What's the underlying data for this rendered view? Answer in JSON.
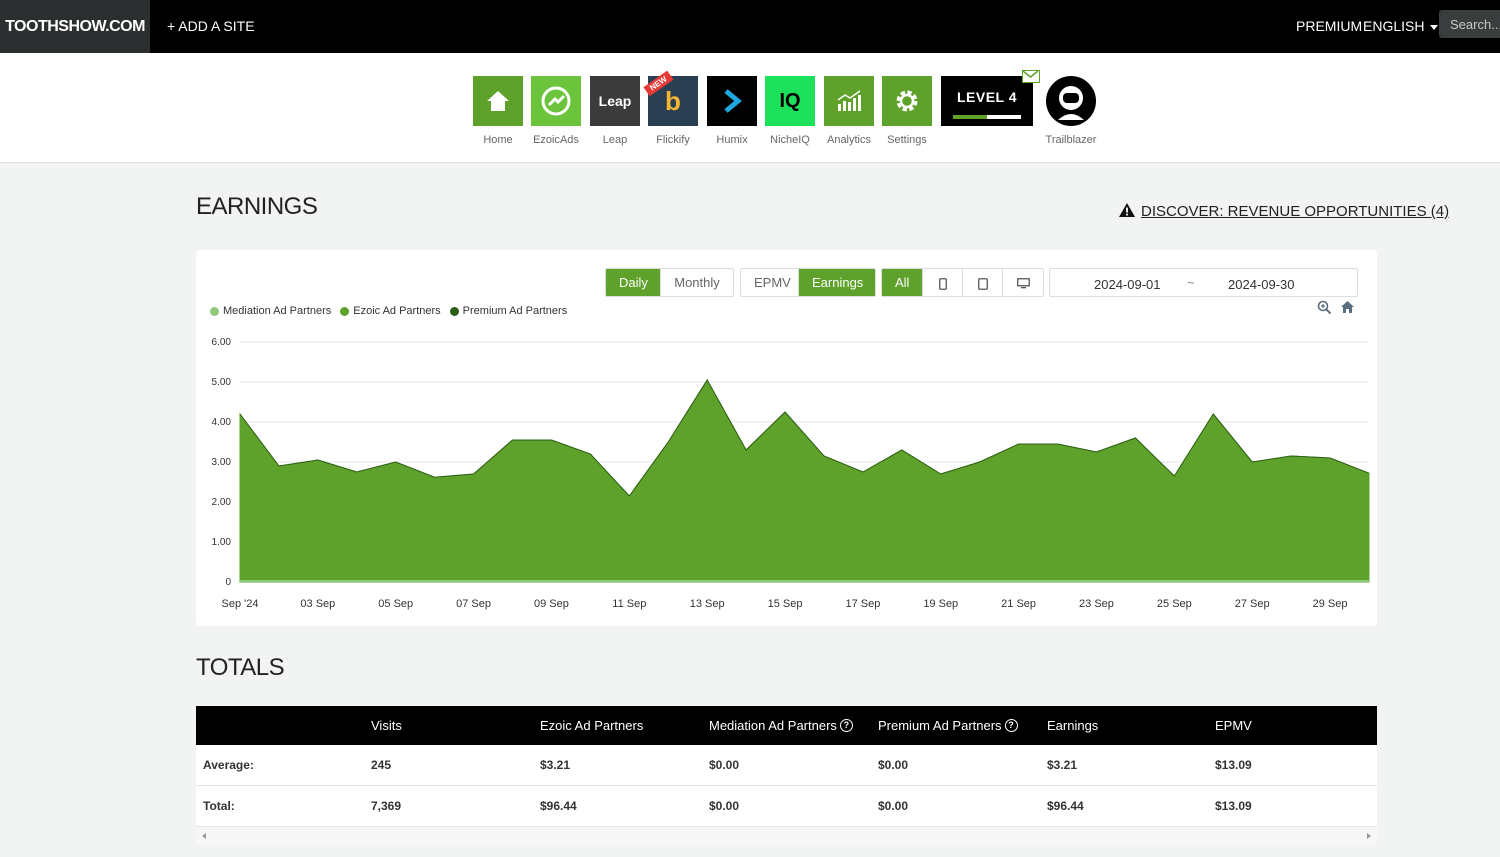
{
  "topbar": {
    "brand": "TOOTHSHOW.COM",
    "add_site": "+ ADD A SITE",
    "premium": "PREMIUM",
    "language": "ENGLISH",
    "search_placeholder": "Search..."
  },
  "apps": [
    {
      "label": "Home",
      "color": "#5ea12b"
    },
    {
      "label": "EzoicAds",
      "color": "#6cc43c"
    },
    {
      "label": "Leap",
      "color": "#3b3b3b"
    },
    {
      "label": "Flickify",
      "color": "#2b3f52",
      "badge": "NEW"
    },
    {
      "label": "Humix",
      "color": "#000000"
    },
    {
      "label": "NicheIQ",
      "color": "#1de05b"
    },
    {
      "label": "Analytics",
      "color": "#5ea12b"
    },
    {
      "label": "Settings",
      "color": "#5ea12b"
    }
  ],
  "level": {
    "label": "LEVEL 4",
    "progress": 0.5
  },
  "trailblazer": {
    "label": "Trailblazer"
  },
  "earnings": {
    "heading": "EARNINGS",
    "discover": "DISCOVER: REVENUE OPPORTUNITIES (4)"
  },
  "controls": {
    "period": [
      "Daily",
      "Monthly"
    ],
    "period_active": "Daily",
    "metric": [
      "EPMV",
      "Earnings"
    ],
    "metric_active": "Earnings",
    "device_all": "All",
    "date_from": "2024-09-01",
    "date_sep": "~",
    "date_to": "2024-09-30"
  },
  "colors": {
    "accent": "#5ea12b",
    "mediation": "#8fc97a",
    "ezoic": "#5ea12b",
    "premium": "#2e5e16"
  },
  "chart_data": {
    "type": "area",
    "x": [
      "2024-09-01",
      "2024-09-02",
      "2024-09-03",
      "2024-09-04",
      "2024-09-05",
      "2024-09-06",
      "2024-09-07",
      "2024-09-08",
      "2024-09-09",
      "2024-09-10",
      "2024-09-11",
      "2024-09-12",
      "2024-09-13",
      "2024-09-14",
      "2024-09-15",
      "2024-09-16",
      "2024-09-17",
      "2024-09-18",
      "2024-09-19",
      "2024-09-20",
      "2024-09-21",
      "2024-09-22",
      "2024-09-23",
      "2024-09-24",
      "2024-09-25",
      "2024-09-26",
      "2024-09-27",
      "2024-09-28",
      "2024-09-29",
      "2024-09-30"
    ],
    "x_tick_labels": [
      "Sep '24",
      "03 Sep",
      "05 Sep",
      "07 Sep",
      "09 Sep",
      "11 Sep",
      "13 Sep",
      "15 Sep",
      "17 Sep",
      "19 Sep",
      "21 Sep",
      "23 Sep",
      "25 Sep",
      "27 Sep",
      "29 Sep"
    ],
    "y_tick_labels": [
      "0",
      "1.00",
      "2.00",
      "3.00",
      "4.00",
      "5.00",
      "6.00"
    ],
    "ylim": [
      0,
      6
    ],
    "grid": true,
    "legend_placement": "top-left",
    "series": [
      {
        "name": "Mediation Ad Partners",
        "values": [
          0,
          0,
          0,
          0,
          0,
          0,
          0,
          0,
          0,
          0,
          0,
          0,
          0,
          0,
          0,
          0,
          0,
          0,
          0,
          0,
          0,
          0,
          0,
          0,
          0,
          0,
          0,
          0,
          0,
          0
        ]
      },
      {
        "name": "Ezoic Ad Partners",
        "values": [
          4.2,
          2.9,
          3.05,
          2.75,
          3.0,
          2.62,
          2.7,
          3.55,
          3.55,
          3.2,
          2.15,
          3.5,
          5.05,
          3.3,
          4.25,
          3.15,
          2.75,
          3.3,
          2.7,
          3.0,
          3.45,
          3.45,
          3.25,
          3.6,
          2.65,
          4.2,
          3.0,
          3.15,
          3.1,
          2.72
        ]
      },
      {
        "name": "Premium Ad Partners",
        "values": [
          0,
          0,
          0,
          0,
          0,
          0,
          0,
          0,
          0,
          0,
          0,
          0,
          0,
          0,
          0,
          0,
          0,
          0,
          0,
          0,
          0,
          0,
          0,
          0,
          0,
          0,
          0,
          0,
          0,
          0
        ]
      }
    ]
  },
  "totals": {
    "heading": "TOTALS",
    "columns": [
      "",
      "Visits",
      "Ezoic Ad Partners",
      "Mediation Ad Partners",
      "Premium Ad Partners",
      "Earnings",
      "EPMV"
    ],
    "help_marks": [
      false,
      false,
      false,
      true,
      true,
      false,
      false
    ],
    "rows": [
      [
        "Average:",
        "245",
        "$3.21",
        "$0.00",
        "$0.00",
        "$3.21",
        "$13.09"
      ],
      [
        "Total:",
        "7,369",
        "$96.44",
        "$0.00",
        "$0.00",
        "$96.44",
        "$13.09"
      ]
    ]
  }
}
